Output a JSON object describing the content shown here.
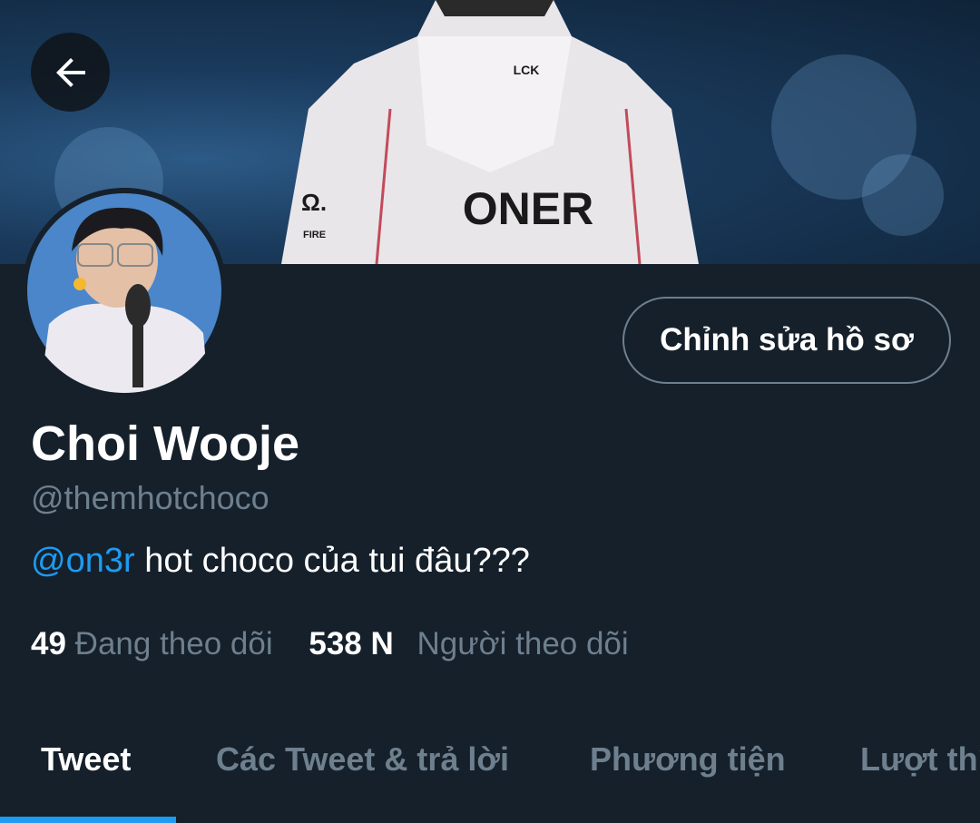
{
  "banner": {
    "jacket_text": "ONER",
    "brand_text": "LCK",
    "sponsor_text": "FIRE"
  },
  "profile": {
    "name": "Choi Wooje",
    "handle": "@themhotchoco",
    "bio_mention": "@on3r",
    "bio_text": " hot choco của tui đâu???",
    "following_count": "49",
    "following_label": "Đang theo dõi",
    "followers_count": "538 N",
    "followers_label": "Người theo dõi"
  },
  "actions": {
    "edit_profile": "Chỉnh sửa hồ sơ"
  },
  "tabs": [
    {
      "label": "Tweet",
      "active": true
    },
    {
      "label": "Các Tweet & trả lời",
      "active": false
    },
    {
      "label": "Phương tiện",
      "active": false
    },
    {
      "label": "Lượt thích",
      "active": false
    }
  ],
  "colors": {
    "background": "#15202b",
    "accent": "#1d9bf0",
    "muted": "#6e7f8e"
  },
  "icons": {
    "back": "arrow-left-icon"
  }
}
